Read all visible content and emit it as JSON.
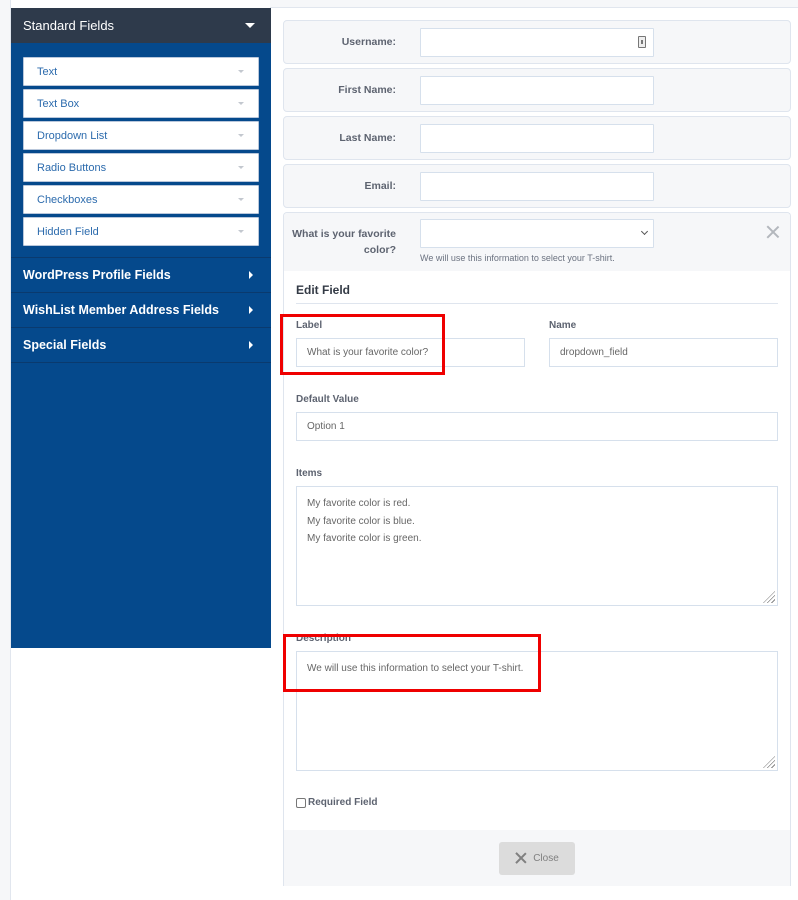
{
  "sidebar": {
    "header": "Standard Fields",
    "items": [
      {
        "label": "Text"
      },
      {
        "label": "Text Box"
      },
      {
        "label": "Dropdown List"
      },
      {
        "label": "Radio Buttons"
      },
      {
        "label": "Checkboxes"
      },
      {
        "label": "Hidden Field"
      }
    ],
    "groups": [
      {
        "label": "WordPress Profile Fields"
      },
      {
        "label": "WishList Member Address Fields"
      },
      {
        "label": "Special Fields"
      }
    ]
  },
  "form": {
    "fields": [
      {
        "label": "Username:",
        "value": ""
      },
      {
        "label": "First Name:",
        "value": ""
      },
      {
        "label": "Last Name:",
        "value": ""
      },
      {
        "label": "Email:",
        "value": ""
      }
    ],
    "dropdown": {
      "label_line1": "What is your favorite",
      "label_line2": "color?",
      "selected": "",
      "help": "We will use this information to select your T-shirt."
    }
  },
  "edit_field": {
    "title": "Edit Field",
    "label_label": "Label",
    "label_value": "What is your favorite color?",
    "name_label": "Name",
    "name_value": "dropdown_field",
    "default_label": "Default Value",
    "default_value": "Option 1",
    "items_label": "Items",
    "items": [
      "My favorite color is red.",
      "My favorite color is blue.",
      "My favorite color is green."
    ],
    "description_label": "Description",
    "description_value": "We will use this information to select your T-shirt.",
    "required_label": "Required Field",
    "required_checked": false,
    "close_label": "Close"
  },
  "colors": {
    "sidebar_bg": "#05498c",
    "sidebar_header_bg": "#2e3a4b",
    "highlight": "#ef0000"
  }
}
